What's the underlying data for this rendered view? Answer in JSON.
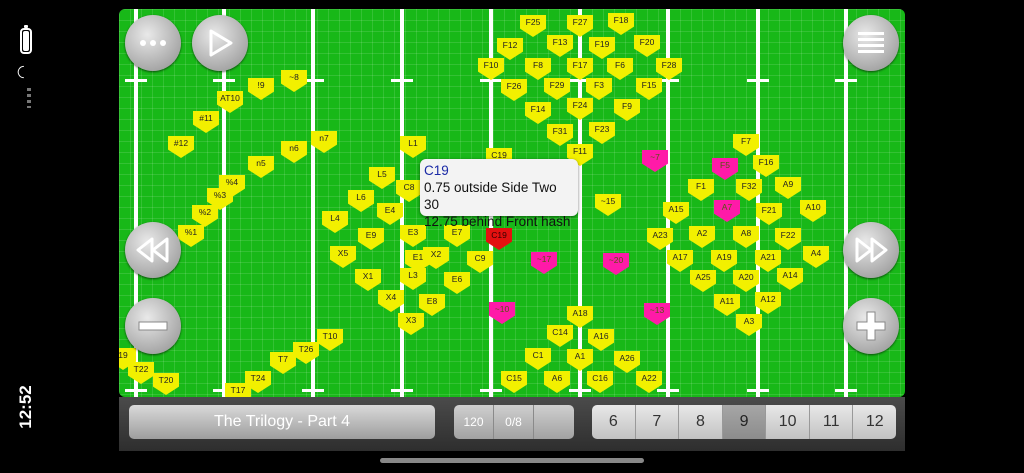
{
  "status": {
    "time": "12:52"
  },
  "tooltip": {
    "title": "C19",
    "line1": "0.75 outside Side Two 30",
    "line2": "12.75 behind Front hash"
  },
  "colors": {
    "field": "#18b818",
    "marker_yellow": "#f2f000",
    "marker_pink": "#ff1aa8",
    "marker_red": "#e31010"
  },
  "buttons": {
    "top_left": [
      "more-icon",
      "play-icon"
    ],
    "top_right": "list-icon",
    "left_middle": [
      "rewind-icon",
      "minus-icon"
    ],
    "right_middle": [
      "fast-forward-icon",
      "plus-icon"
    ]
  },
  "marker_labels": [
    "F25",
    "F27",
    "F18",
    "F12",
    "F13",
    "F19",
    "F20",
    "F10",
    "F8",
    "F17",
    "F6",
    "F28",
    "F26",
    "F29",
    "F3",
    "F15",
    "~8",
    "!9",
    "AT10",
    "#11",
    "F14",
    "F24",
    "F9",
    "F31",
    "F23",
    "n7",
    "#12",
    "n6",
    "n5",
    "L1",
    "F11",
    "~7",
    "F7",
    "F5",
    "F16",
    "C19",
    "%4",
    "L5",
    "C8",
    "F1",
    "F32",
    "A9",
    "%3",
    "L6",
    "E4",
    "~15",
    "A15",
    "A7",
    "F21",
    "A10",
    "%2",
    "L4",
    "E3",
    "E7",
    "C19",
    "A23",
    "A2",
    "A8",
    "F22",
    "%1",
    "E9",
    "X5",
    "E1",
    "X2",
    "C9",
    "~17",
    "~20",
    "A17",
    "A19",
    "A21",
    "A4",
    "X1",
    "L3",
    "E6",
    "A25",
    "A20",
    "A14",
    "X4",
    "E8",
    "A11",
    "A12",
    "~10",
    "A18",
    "~13",
    "X3",
    "A3",
    "C14",
    "A16",
    "T10",
    "T26",
    "C1",
    "A1",
    "A26",
    "T7",
    "19",
    "T22",
    "C15",
    "A6",
    "C16",
    "A22",
    "T20",
    "T24",
    "T17"
  ],
  "bottom": {
    "title": "The Trilogy - Part 4",
    "count": "120",
    "progress": "0/8",
    "pages": [
      "6",
      "7",
      "8",
      "9",
      "10",
      "11",
      "12"
    ],
    "active_page": "9"
  }
}
